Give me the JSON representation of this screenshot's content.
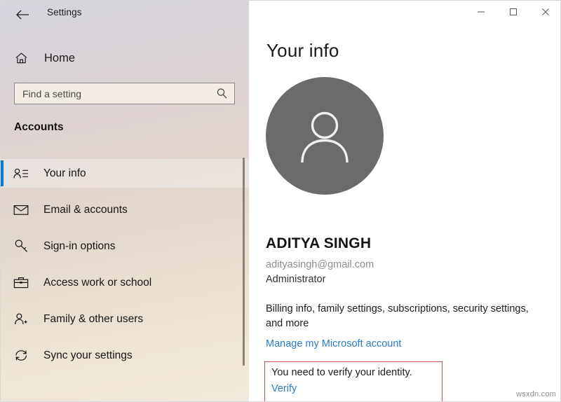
{
  "window": {
    "title": "Settings",
    "back_icon": "back-arrow-icon",
    "controls": {
      "minimize": "─",
      "maximize": "□",
      "close": "×"
    }
  },
  "sidebar": {
    "home_label": "Home",
    "home_icon": "home-icon",
    "search": {
      "placeholder": "Find a setting",
      "value": "",
      "icon": "search-icon"
    },
    "section_title": "Accounts",
    "items": [
      {
        "label": "Your info",
        "icon": "user-card-icon",
        "selected": true
      },
      {
        "label": "Email & accounts",
        "icon": "envelope-icon",
        "selected": false
      },
      {
        "label": "Sign-in options",
        "icon": "key-icon",
        "selected": false
      },
      {
        "label": "Access work or school",
        "icon": "briefcase-icon",
        "selected": false
      },
      {
        "label": "Family & other users",
        "icon": "user-add-icon",
        "selected": false
      },
      {
        "label": "Sync your settings",
        "icon": "sync-icon",
        "selected": false
      }
    ]
  },
  "main": {
    "page_title": "Your info",
    "avatar_icon": "person-avatar-icon",
    "user_name": "ADITYA SINGH",
    "user_email": "adityasingh@gmail.com",
    "user_role": "Administrator",
    "billing_text": "Billing info, family settings, subscriptions, security settings, and more",
    "manage_link": "Manage my Microsoft account",
    "verify": {
      "message": "You need to verify your identity.",
      "link": "Verify"
    }
  },
  "watermark": "wsxdn.com",
  "colors": {
    "accent_blue": "#0a7bd4",
    "link_blue": "#2a7cc7",
    "verify_border": "#c0504d",
    "avatar_gray": "#6b6b6b"
  }
}
